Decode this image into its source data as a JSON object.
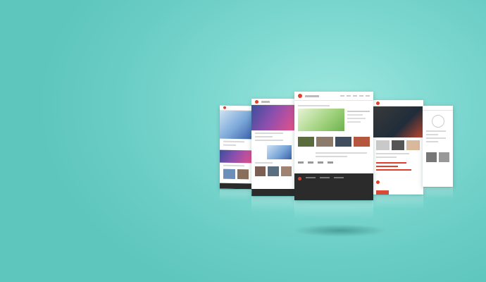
{
  "scene": {
    "description_items": [
      "far-left-page",
      "left-page",
      "center-page",
      "right-page",
      "far-right-page"
    ],
    "colors": {
      "background": "#7dd8d0",
      "accent": "#e0402b",
      "footer": "#2b2b2b"
    }
  }
}
